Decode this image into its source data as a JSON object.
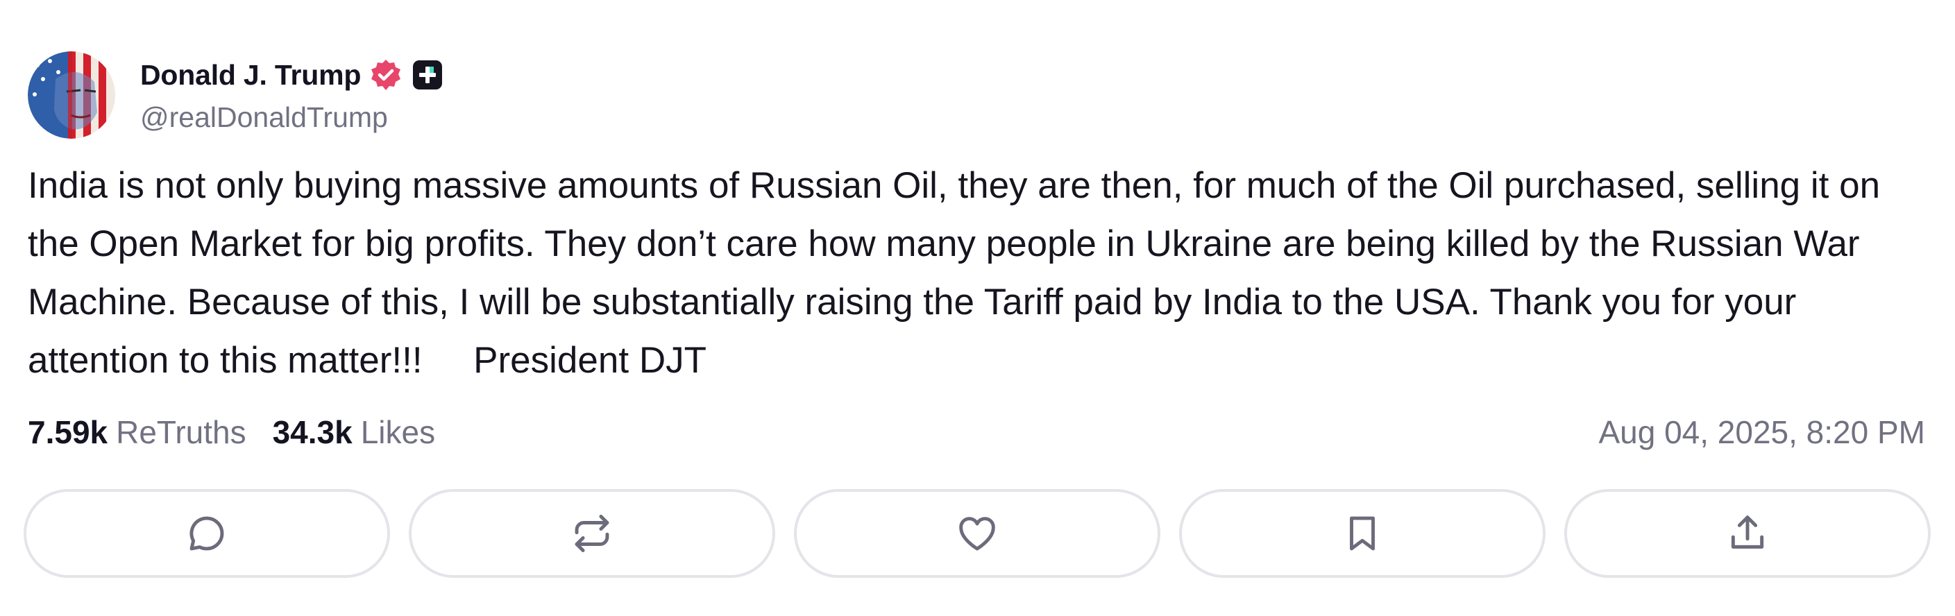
{
  "author": {
    "display_name": "Donald J. Trump",
    "handle": "@realDonaldTrump",
    "avatar_icon": "avatar-flag-portrait",
    "verified_icon": "verified-badge-icon",
    "verified_color": "#e8456b",
    "plus_icon": "plus-badge-icon"
  },
  "post": {
    "text": "India is not only buying massive amounts of Russian Oil, they are then, for much of the Oil purchased, selling it on the Open Market for big profits. They don’t care how many people in Ukraine are being killed by the Russian War Machine. Because of this, I will be substantially raising the Tariff paid by India to the USA. Thank you for your attention to this matter!!!     President DJT",
    "timestamp": "Aug 04, 2025, 8:20 PM"
  },
  "stats": {
    "retruths_count": "7.59k",
    "retruths_label": "ReTruths",
    "likes_count": "34.3k",
    "likes_label": "Likes"
  },
  "actions": [
    {
      "name": "reply",
      "icon": "comment-icon"
    },
    {
      "name": "retruth",
      "icon": "repost-icon"
    },
    {
      "name": "like",
      "icon": "heart-icon"
    },
    {
      "name": "bookmark",
      "icon": "bookmark-icon"
    },
    {
      "name": "share",
      "icon": "share-icon"
    }
  ],
  "colors": {
    "text": "#16151f",
    "muted": "#717182",
    "border": "#e4e4e9",
    "icon": "#6b6b7b"
  }
}
